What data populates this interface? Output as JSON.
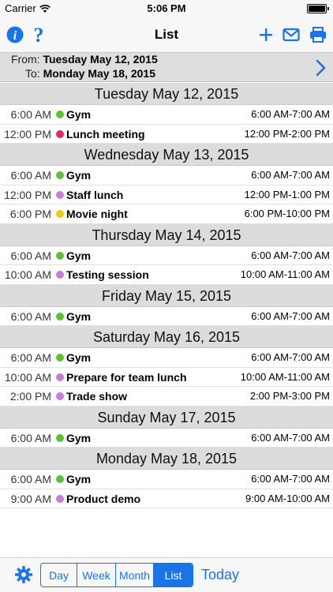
{
  "status": {
    "carrier": "Carrier",
    "time": "5:06 PM"
  },
  "nav": {
    "title": "List",
    "icons": [
      "info-icon",
      "help-icon",
      "add-icon",
      "mail-icon",
      "print-icon"
    ]
  },
  "range": {
    "from_label": "From:",
    "from_value": "Tuesday May 12, 2015",
    "to_label": "To:",
    "to_value": "Monday May 18, 2015"
  },
  "days": [
    {
      "header": "Tuesday May 12, 2015",
      "events": [
        {
          "time": "6:00 AM",
          "title": "Gym",
          "range": "6:00 AM-7:00 AM",
          "color": "#5bc236"
        },
        {
          "time": "12:00 PM",
          "title": "Lunch meeting",
          "range": "12:00 PM-2:00 PM",
          "color": "#e8265e"
        }
      ]
    },
    {
      "header": "Wednesday May 13, 2015",
      "events": [
        {
          "time": "6:00 AM",
          "title": "Gym",
          "range": "6:00 AM-7:00 AM",
          "color": "#5bc236"
        },
        {
          "time": "12:00 PM",
          "title": "Staff lunch",
          "range": "12:00 PM-1:00 PM",
          "color": "#c57be0"
        },
        {
          "time": "6:00 PM",
          "title": "Movie night",
          "range": "6:00 PM-10:00 PM",
          "color": "#f5c518"
        }
      ]
    },
    {
      "header": "Thursday May 14, 2015",
      "events": [
        {
          "time": "6:00 AM",
          "title": "Gym",
          "range": "6:00 AM-7:00 AM",
          "color": "#5bc236"
        },
        {
          "time": "10:00 AM",
          "title": "Testing session",
          "range": "10:00 AM-11:00 AM",
          "color": "#c57be0"
        }
      ]
    },
    {
      "header": "Friday May 15, 2015",
      "events": [
        {
          "time": "6:00 AM",
          "title": "Gym",
          "range": "6:00 AM-7:00 AM",
          "color": "#5bc236"
        }
      ]
    },
    {
      "header": "Saturday May 16, 2015",
      "events": [
        {
          "time": "6:00 AM",
          "title": "Gym",
          "range": "6:00 AM-7:00 AM",
          "color": "#5bc236"
        },
        {
          "time": "10:00 AM",
          "title": "Prepare for team lunch",
          "range": "10:00 AM-11:00 AM",
          "color": "#c57be0"
        },
        {
          "time": "2:00 PM",
          "title": "Trade show",
          "range": "2:00 PM-3:00 PM",
          "color": "#c57be0"
        }
      ]
    },
    {
      "header": "Sunday May 17, 2015",
      "events": [
        {
          "time": "6:00 AM",
          "title": "Gym",
          "range": "6:00 AM-7:00 AM",
          "color": "#5bc236"
        }
      ]
    },
    {
      "header": "Monday May 18, 2015",
      "events": [
        {
          "time": "6:00 AM",
          "title": "Gym",
          "range": "6:00 AM-7:00 AM",
          "color": "#5bc236"
        },
        {
          "time": "9:00 AM",
          "title": "Product demo",
          "range": "9:00 AM-10:00 AM",
          "color": "#c57be0"
        }
      ]
    }
  ],
  "toolbar": {
    "views": [
      "Day",
      "Week",
      "Month",
      "List"
    ],
    "active_view": "List",
    "today_label": "Today"
  },
  "colors": {
    "accent": "#1a73e8",
    "header_bg": "#dcdcdc"
  }
}
